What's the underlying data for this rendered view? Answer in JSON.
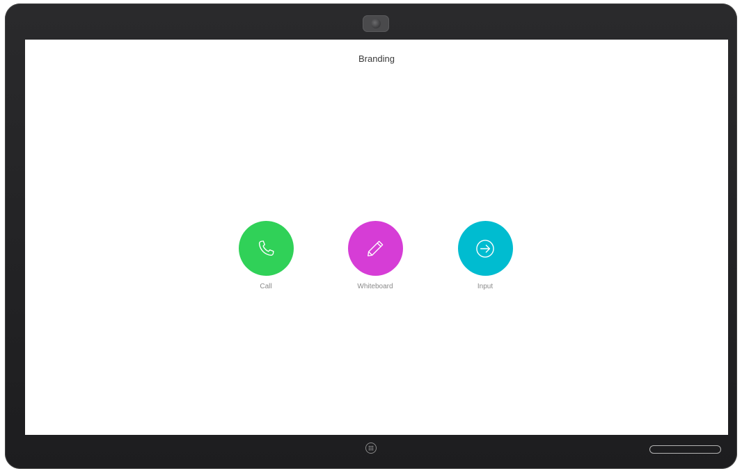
{
  "screen": {
    "branding_text": "Branding"
  },
  "actions": [
    {
      "label": "Call",
      "color": "#30d158",
      "icon": "phone-icon"
    },
    {
      "label": "Whiteboard",
      "color": "#d63dd6",
      "icon": "pencil-icon"
    },
    {
      "label": "Input",
      "color": "#00bcd0",
      "icon": "arrow-right-circle-icon"
    }
  ],
  "colors": {
    "bezel": "#1f1f21",
    "screen": "#ffffff",
    "label_text": "#8a8a8a"
  }
}
